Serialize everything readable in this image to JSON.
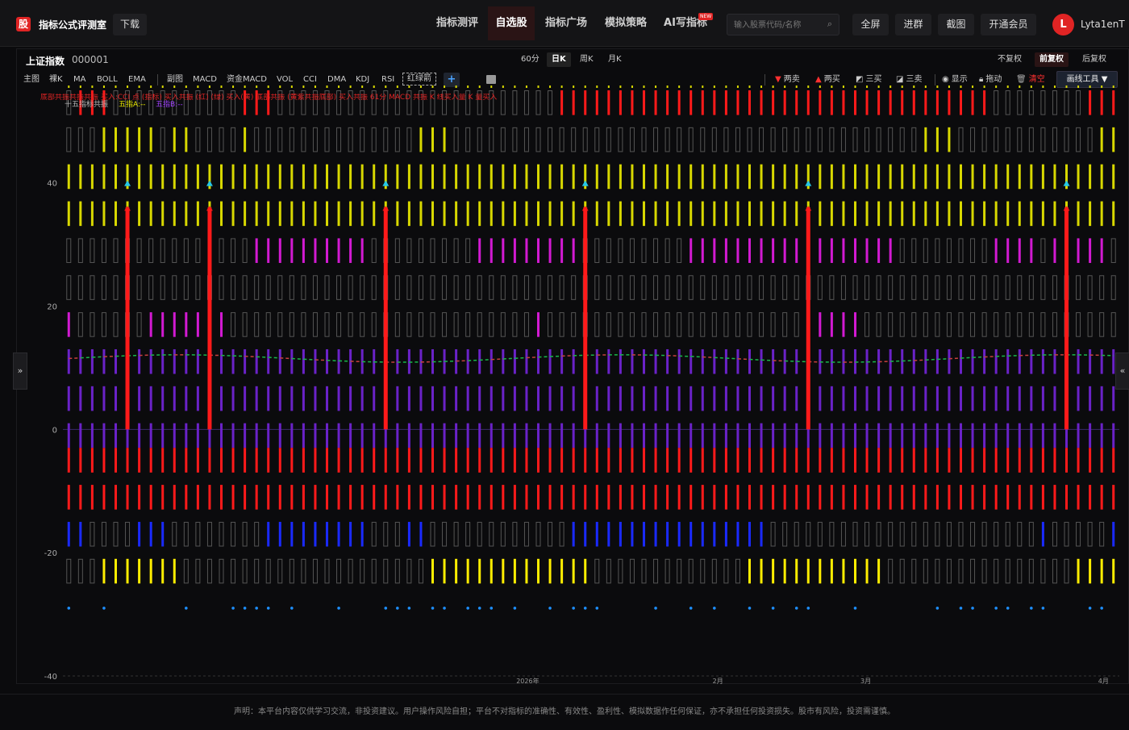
{
  "header": {
    "logo_char": "股",
    "app_title": "指标公式评测室",
    "download_label": "下载",
    "nav": [
      "指标测评",
      "自选股",
      "指标广场",
      "模拟策略",
      "AI写指标"
    ],
    "nav_active": "自选股",
    "new_badge": "NEW",
    "search_placeholder": "输入股票代码/名称",
    "buttons": [
      "全屏",
      "进群",
      "截图",
      "开通会员"
    ],
    "avatar_letter": "L",
    "username": "Lyta1enT"
  },
  "toolbar": {
    "index_name": "上证指数",
    "index_code": "000001",
    "timeframes": [
      "60分",
      "日K",
      "周K",
      "月K"
    ],
    "timeframe_active": "日K",
    "adjustments": [
      "不复权",
      "前复权",
      "后复权"
    ],
    "adjustment_active": "前复权",
    "indicators": [
      "主图",
      "裸K",
      "MA",
      "BOLL",
      "EMA",
      "副图",
      "MACD",
      "资金MACD",
      "VOL",
      "CCI",
      "DMA",
      "KDJ",
      "RSI"
    ],
    "active_indicator": "红绿箭",
    "plus_label": "+",
    "tools": {
      "two_sell": "两卖",
      "two_buy": "两买",
      "three_buy": "三买",
      "three_sell": "三卖",
      "show": "显示",
      "drag": "拖动",
      "clear": "清空"
    },
    "draw_tool": "画线工具 ▼",
    "left_toggle": "»",
    "right_toggle": "«"
  },
  "chart_data": {
    "type": "bar",
    "ylim": [
      -40,
      55
    ],
    "y_ticks": [
      40,
      20,
      0,
      -20,
      -40
    ],
    "x_ticks": [
      "2026年",
      "2月",
      "3月",
      "4月"
    ],
    "legend_line1": "底部共振共振共振 买入:CCI 点 (指标) 买入共振 (红) (绿) 买入(黄) 底部共振 (黄紫共振底部) 买入共振 61分 MACD 共振 K 线买入量 K 量买入",
    "legend_line2_label": "十五指标共振",
    "legend_line2_a": "五指A:--",
    "legend_line2_b": "五指B:--",
    "marker_positions_index": [
      5,
      12,
      27,
      44,
      63,
      85
    ],
    "bar_count": 90,
    "row_levels": [
      55,
      49,
      43,
      37,
      31,
      25,
      19,
      13,
      7,
      1,
      -3,
      -9,
      -15,
      -21
    ],
    "dot_row_level": -29
  },
  "footer": {
    "disclaimer": "声明：本平台内容仅供学习交流，非投资建议。用户操作风险自担；平台不对指标的准确性、有效性、盈利性、模拟数据作任何保证，亦不承担任何投资损失。股市有风险，投资需谨慎。"
  },
  "colors": {
    "red": "#ff1a1a",
    "yellow": "#d8d800",
    "bright_yellow": "#ffee00",
    "purple": "#6a22c8",
    "magenta": "#d21ad2",
    "blue": "#1a2aff",
    "cyan": "#25c7e8",
    "gray": "#8a8a8a"
  }
}
